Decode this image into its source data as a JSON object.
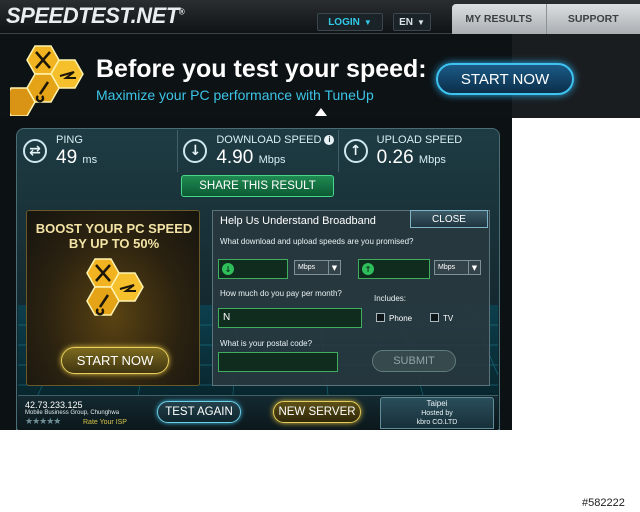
{
  "colors": {
    "accent_cyan": "#32c8e8",
    "accent_green": "#3fae5f",
    "accent_gold": "#e6cc58",
    "bg_dark": "#0c1114"
  },
  "header": {
    "logo": "SPEEDTEST.NET",
    "login_label": "LOGIN",
    "language_label": "EN",
    "tabs": [
      "MY RESULTS",
      "SUPPORT"
    ]
  },
  "banner": {
    "title": "Before you test your speed:",
    "subtitle": "Maximize your PC performance with TuneUp",
    "start_label": "START NOW",
    "icon": "tools-hexagon-icon"
  },
  "results": {
    "ping": {
      "label": "PING",
      "value": "49",
      "unit": "ms",
      "icon": "ping-arrows-icon"
    },
    "download": {
      "label": "DOWNLOAD SPEED",
      "value": "4.90",
      "unit": "Mbps",
      "icon": "download-arrow-icon"
    },
    "upload": {
      "label": "UPLOAD SPEED",
      "value": "0.26",
      "unit": "Mbps",
      "icon": "upload-arrow-icon"
    },
    "share_label": "SHARE THIS RESULT"
  },
  "boost": {
    "title_line1": "BOOST YOUR PC SPEED",
    "title_line2": "BY UP TO 50%",
    "start_label": "START NOW"
  },
  "survey": {
    "title": "Help Us Understand Broadband",
    "close_label": "CLOSE",
    "q_speeds": "What download and upload speeds are you promised?",
    "download_unit": "Mbps",
    "upload_unit": "Mbps",
    "q_price": "How much do you pay per month?",
    "price_value": "N",
    "includes_label": "Includes:",
    "phone_label": "Phone",
    "tv_label": "TV",
    "q_postal": "What is your postal code?",
    "submit_label": "SUBMIT"
  },
  "footer": {
    "ip": "42.73.233.125",
    "isp": "Mobile Business Group, Chunghwa",
    "stars": "★★★★★",
    "rate_label": "Rate Your ISP",
    "test_again_label": "TEST AGAIN",
    "new_server_label": "NEW SERVER",
    "server_city": "Taipei",
    "hosted_by": "Hosted by",
    "host_name": "kbro CO.LTD"
  },
  "watermark": "#582222"
}
